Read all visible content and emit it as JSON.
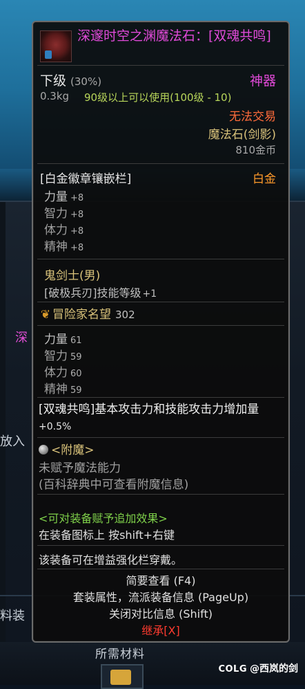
{
  "background": {
    "left_labels": [
      "深",
      "放入",
      "料装"
    ],
    "bottom_label": "所需材料",
    "watermark": {
      "logo": "COLG",
      "handle": "@西岚的剑"
    }
  },
  "tooltip": {
    "title": "深邃时空之渊魔法石：[双魂共鸣]",
    "grade": "下级",
    "grade_percent": "(30%)",
    "rarity": "神器",
    "weight": "0.3kg",
    "level_requirement": "90级以上可以使用(100级 - 10)",
    "trade_status": "无法交易",
    "item_type": "魔法石(剑影)",
    "price": "810金币",
    "slot_title": "[白金徽章镶嵌栏]",
    "slot_type": "白金",
    "platinum_stats": [
      {
        "label": "力量",
        "value": "+8"
      },
      {
        "label": "智力",
        "value": "+8"
      },
      {
        "label": "体力",
        "value": "+8"
      },
      {
        "label": "精神",
        "value": "+8"
      }
    ],
    "job": "鬼剑士(男)",
    "skill_label": "[破极兵刃]技能等级",
    "skill_value": "+1",
    "reputation_label": "冒险家名望",
    "reputation_value": "302",
    "base_stats": [
      {
        "label": "力量",
        "value": "61"
      },
      {
        "label": "智力",
        "value": "59"
      },
      {
        "label": "体力",
        "value": "60"
      },
      {
        "label": "精神",
        "value": "59"
      }
    ],
    "set_bonus_text": "[双魂共鸣]基本攻击力和技能攻击力增加量",
    "set_bonus_value": "+0.5%",
    "enchant_title": "<附魔>",
    "enchant_line1": "未赋予魔法能力",
    "enchant_line2": "(百科辞典中可查看附魔信息)",
    "addon_title": "<可对装备赋予追加效果>",
    "addon_hint": "在装备图标上 按shift+右键",
    "equip_note": "该装备可在增益强化栏穿戴。",
    "footer_lines": [
      "简要查看 (F4)",
      "套装属性，流派装备信息 (PageUp)",
      "关闭对比信息 (Shift)"
    ],
    "inherit_label": "继承[X]",
    "colors": {
      "title": "#e04ad8",
      "rarity": "#e04ad8",
      "trade_status": "#ff6b3a",
      "gold_text": "#d9c27a",
      "level_text": "#b8d65a",
      "addon_text": "#7fd14a",
      "slot_type": "#ff9a2a",
      "inherit": "#ff3b2f"
    },
    "icons": {
      "item": "magic-stone-icon",
      "reputation": "laurel-icon",
      "enchant": "orb-icon"
    }
  }
}
